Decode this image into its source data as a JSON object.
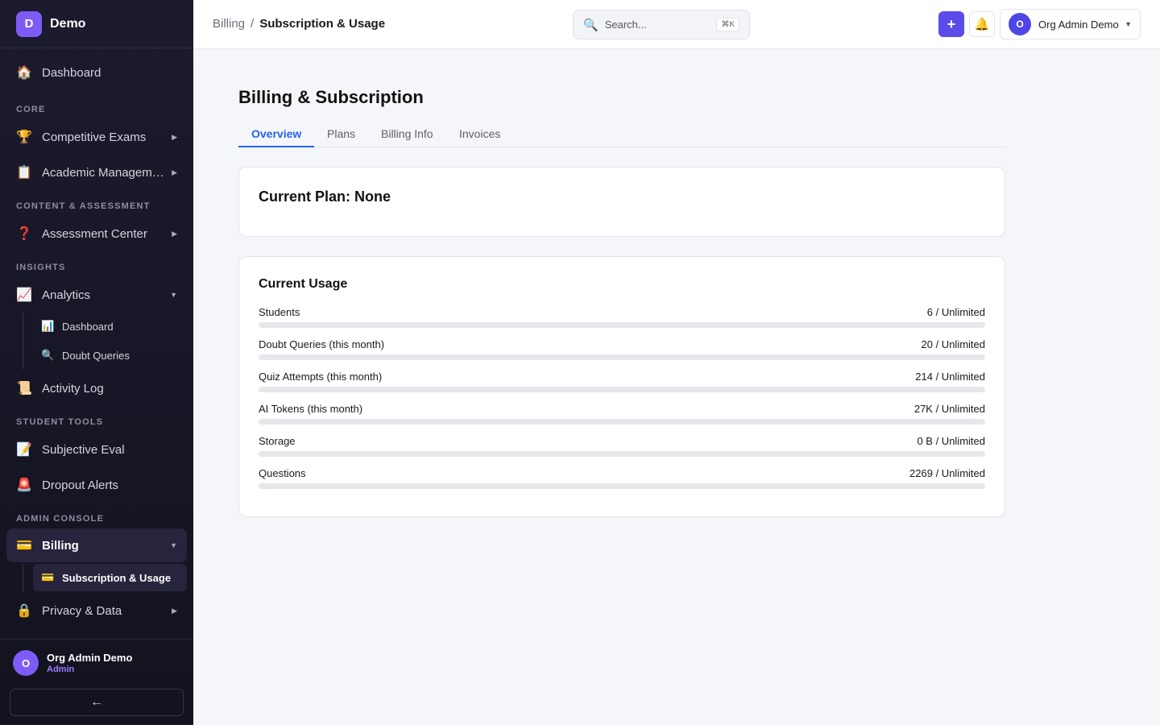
{
  "brand": {
    "logo_letter": "D",
    "name": "Demo"
  },
  "sidebar": {
    "dashboard": {
      "icon": "home-icon",
      "glyph": "🏠",
      "label": "Dashboard"
    },
    "sections": {
      "core": "CORE",
      "content": "CONTENT & ASSESSMENT",
      "insights": "INSIGHTS",
      "student_tools": "STUDENT TOOLS",
      "admin_console": "ADMIN CONSOLE"
    },
    "competitive_exams": {
      "icon": "trophy-icon",
      "glyph": "🏆",
      "label": "Competitive Exams"
    },
    "academic_management": {
      "icon": "clipboard-icon",
      "glyph": "📋",
      "label": "Academic Management"
    },
    "assessment_center": {
      "icon": "question-icon",
      "glyph": "❓",
      "label": "Assessment Center"
    },
    "analytics": {
      "icon": "chart-icon",
      "glyph": "📈",
      "label": "Analytics",
      "expanded": true,
      "children": [
        {
          "icon": "bar-chart-icon",
          "glyph": "📊",
          "label": "Dashboard"
        },
        {
          "icon": "magnifier-icon",
          "glyph": "🔍",
          "label": "Doubt Queries"
        }
      ]
    },
    "activity_log": {
      "icon": "scroll-icon",
      "glyph": "📜",
      "label": "Activity Log"
    },
    "subjective_eval": {
      "icon": "memo-icon",
      "glyph": "📝",
      "label": "Subjective Eval"
    },
    "dropout_alerts": {
      "icon": "siren-icon",
      "glyph": "🚨",
      "label": "Dropout Alerts"
    },
    "billing": {
      "icon": "credit-card-icon",
      "glyph": "💳",
      "label": "Billing",
      "expanded": true,
      "active": true,
      "children": [
        {
          "icon": "credit-card-icon",
          "glyph": "💳",
          "label": "Subscription & Usage",
          "active": true
        }
      ]
    },
    "privacy": {
      "icon": "lock-icon",
      "glyph": "🔒",
      "label": "Privacy & Data"
    },
    "footer": {
      "avatar_letter": "O",
      "user_name": "Org Admin Demo",
      "user_role": "Admin",
      "collapse_glyph": "←"
    }
  },
  "topbar": {
    "breadcrumb": {
      "parent": "Billing",
      "separator": "/",
      "current": "Subscription & Usage"
    },
    "search": {
      "placeholder": "Search...",
      "shortcut": "⌘K",
      "icon": "search-icon",
      "glyph": "🔍"
    },
    "add_glyph": "+",
    "bell_glyph": "🔔",
    "user": {
      "avatar_letter": "O",
      "name": "Org Admin Demo",
      "caret": "▼"
    }
  },
  "main": {
    "title": "Billing & Subscription",
    "tabs": [
      {
        "label": "Overview",
        "active": true
      },
      {
        "label": "Plans"
      },
      {
        "label": "Billing Info"
      },
      {
        "label": "Invoices"
      }
    ],
    "plan": {
      "title": "Current Plan: None"
    },
    "usage": {
      "title": "Current Usage",
      "rows": [
        {
          "label": "Students",
          "value": "6 / Unlimited",
          "fill_fraction": 0
        },
        {
          "label": "Doubt Queries (this month)",
          "value": "20 / Unlimited",
          "fill_fraction": 0
        },
        {
          "label": "Quiz Attempts (this month)",
          "value": "214 / Unlimited",
          "fill_fraction": 0
        },
        {
          "label": "AI Tokens (this month)",
          "value": "27K / Unlimited",
          "fill_fraction": 0
        },
        {
          "label": "Storage",
          "value": "0 B / Unlimited",
          "fill_fraction": 0
        },
        {
          "label": "Questions",
          "value": "2269 / Unlimited",
          "fill_fraction": 0
        }
      ]
    }
  },
  "colors": {
    "accent": "#5b4ce8",
    "tab_active": "#2563eb",
    "sidebar_bg": "#1c1b2e",
    "brand_purple": "#7c5cf4",
    "role_purple": "#9f7bff"
  }
}
